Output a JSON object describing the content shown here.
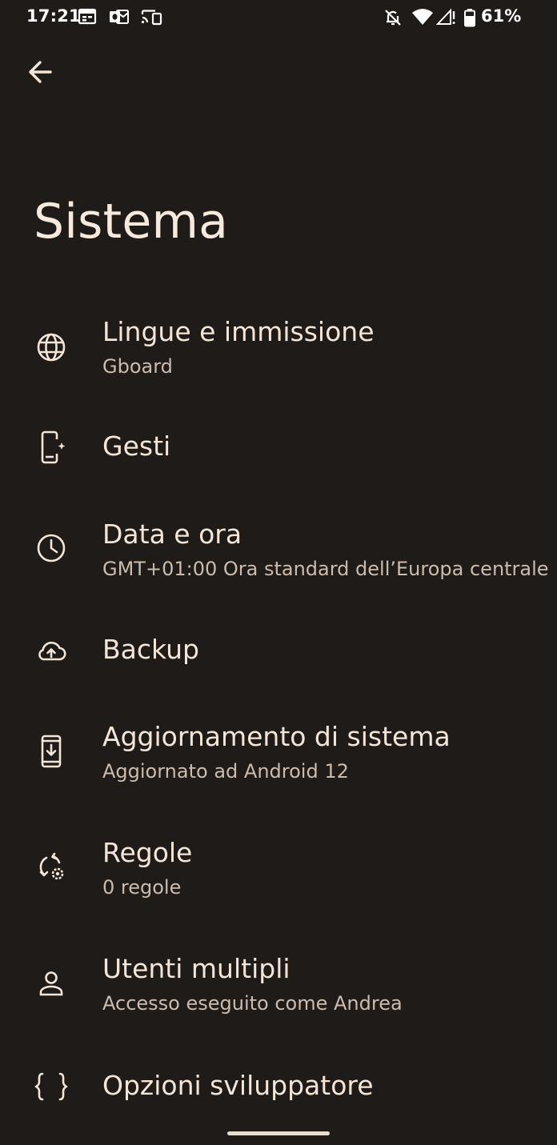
{
  "status_bar": {
    "time": "17:21",
    "battery_percent": "61%",
    "icons": [
      "calendar-icon",
      "outlook-icon",
      "cast-icon",
      "notifications-off-icon",
      "wifi-icon",
      "signal-icon",
      "battery-icon"
    ]
  },
  "toolbar": {
    "back_icon": "arrow-back-icon"
  },
  "page": {
    "title": "Sistema"
  },
  "settings": [
    {
      "title": "Lingue e immissione",
      "summary": "Gboard",
      "icon": "globe-icon"
    },
    {
      "title": "Gesti",
      "summary": "",
      "icon": "gesture-phone-icon"
    },
    {
      "title": "Data e ora",
      "summary": "GMT+01:00 Ora standard dell’Europa centrale",
      "icon": "clock-icon"
    },
    {
      "title": "Backup",
      "summary": "",
      "icon": "cloud-upload-icon"
    },
    {
      "title": "Aggiornamento di sistema",
      "summary": "Aggiornato ad Android 12",
      "icon": "system-update-icon"
    },
    {
      "title": "Regole",
      "summary": "0 regole",
      "icon": "rules-icon"
    },
    {
      "title": "Utenti multipli",
      "summary": "Accesso eseguito come Andrea",
      "icon": "person-icon"
    },
    {
      "title": "Opzioni sviluppatore",
      "summary": "",
      "icon": "code-braces-icon"
    }
  ],
  "colors": {
    "background": "#1f1b18",
    "text_primary": "#f3e6d8",
    "text_secondary": "#cbbcad"
  }
}
